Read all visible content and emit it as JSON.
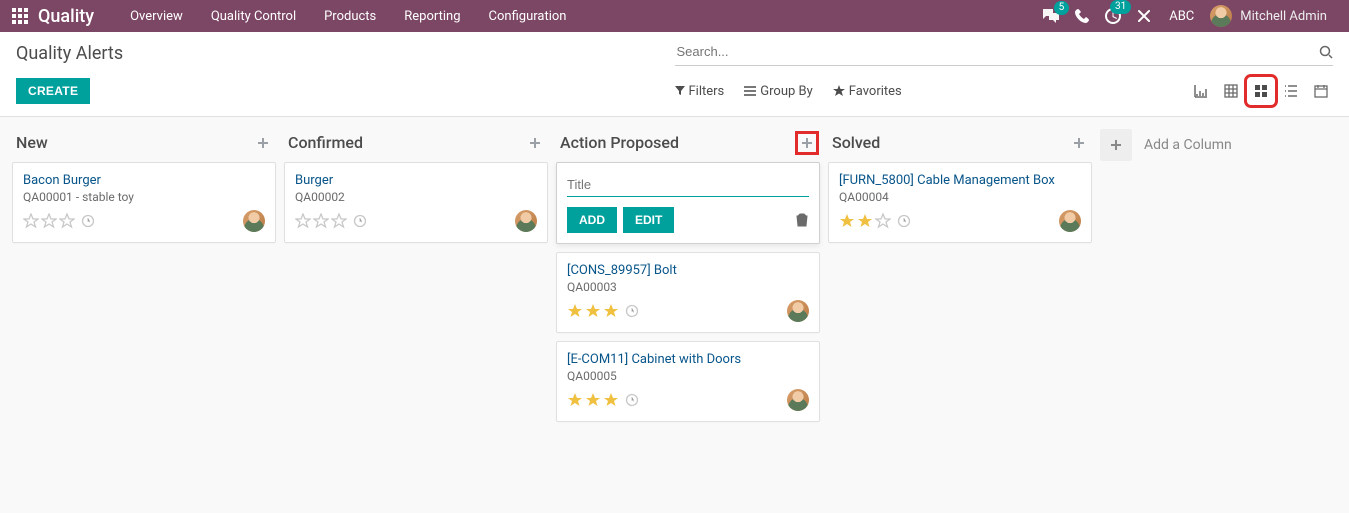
{
  "nav": {
    "app_title": "Quality",
    "links": [
      "Overview",
      "Quality Control",
      "Products",
      "Reporting",
      "Configuration"
    ],
    "discuss_badge": "5",
    "activities_badge": "31",
    "company": "ABC",
    "username": "Mitchell Admin"
  },
  "breadcrumb": "Quality Alerts",
  "search": {
    "placeholder": "Search..."
  },
  "buttons": {
    "create": "CREATE",
    "filters": "Filters",
    "group_by": "Group By",
    "favorites": "Favorites"
  },
  "kanban": {
    "columns": [
      {
        "title": "New",
        "cards": [
          {
            "title": "Bacon Burger",
            "sub": "QA00001 - stable toy",
            "stars": 0,
            "avatar": true
          }
        ]
      },
      {
        "title": "Confirmed",
        "cards": [
          {
            "title": "Burger",
            "sub": "QA00002",
            "stars": 0,
            "avatar": true
          }
        ]
      },
      {
        "title": "Action Proposed",
        "quick_create": {
          "placeholder": "Title",
          "add_label": "ADD",
          "edit_label": "EDIT"
        },
        "cards": [
          {
            "title": "[CONS_89957] Bolt",
            "sub": "QA00003",
            "stars": 3,
            "avatar": true
          },
          {
            "title": "[E-COM11] Cabinet with Doors",
            "sub": "QA00005",
            "stars": 3,
            "avatar": true
          }
        ]
      },
      {
        "title": "Solved",
        "cards": [
          {
            "title": "[FURN_5800] Cable Management Box",
            "sub": "QA00004",
            "stars": 2,
            "avatar": true
          }
        ]
      }
    ],
    "add_column_label": "Add a Column"
  }
}
